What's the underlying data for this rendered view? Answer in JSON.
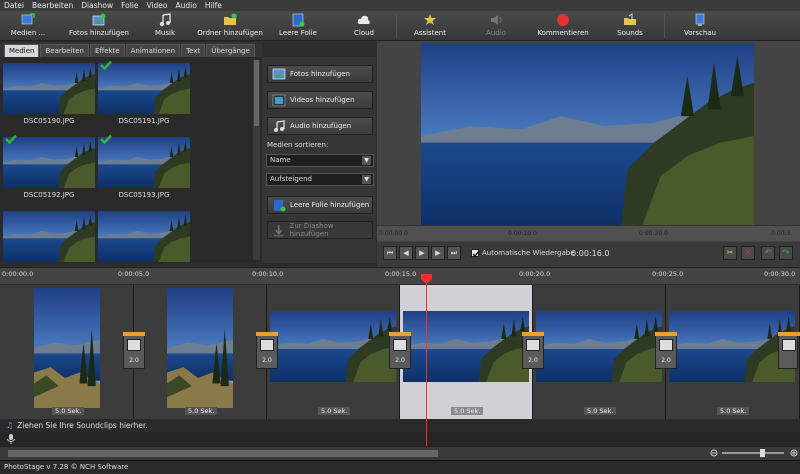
{
  "menu": [
    "Datei",
    "Bearbeiten",
    "Diashow",
    "Folie",
    "Video",
    "Audio",
    "Hilfe"
  ],
  "toolbar": [
    {
      "label": "Medien ...",
      "icon": "media-icon"
    },
    {
      "label": "Fotos hinzufügen",
      "icon": "photo-add-icon"
    },
    {
      "label": "Musik",
      "icon": "music-icon"
    },
    {
      "label": "Ordner hinzufügen",
      "icon": "folder-add-icon"
    },
    {
      "label": "Leere Folie",
      "icon": "blank-slide-icon"
    },
    {
      "label": "Cloud",
      "icon": "cloud-icon"
    },
    {
      "label": "Assistent",
      "icon": "wizard-icon"
    },
    {
      "label": "Audio",
      "icon": "audio-icon"
    },
    {
      "label": "Kommentieren",
      "icon": "record-icon"
    },
    {
      "label": "Sounds",
      "icon": "sounds-icon"
    },
    {
      "label": "Vorschau",
      "icon": "preview-icon"
    }
  ],
  "tabs": [
    "Medien",
    "Bearbeiten",
    "Effekte",
    "Animationen",
    "Text",
    "Übergänge"
  ],
  "media": [
    {
      "name": "DSC05190.JPG",
      "used": false
    },
    {
      "name": "DSC05191.JPG",
      "used": true
    },
    {
      "name": "DSC05192.JPG",
      "used": true
    },
    {
      "name": "DSC05193.JPG",
      "used": true
    }
  ],
  "side": {
    "add_photos": "Fotos hinzufügen",
    "add_videos": "Videos hinzufügen",
    "add_audio": "Audio hinzufügen",
    "sort_label": "Medien sortieren:",
    "sort_by": "Name",
    "sort_order": "Aufsteigend",
    "add_blank": "Leere Folie hinzufügen",
    "add_to_slideshow": "Zur Diashow hinzufügen"
  },
  "preview": {
    "ruler": [
      "0:00:00.0",
      "0:00:10.0",
      "0:00:20.0",
      "0:00:3"
    ],
    "autoplay_label": "Automatische Wiedergabe",
    "time": "0:00:16.0"
  },
  "timeline": {
    "ruler": [
      "0:00:00.0",
      "0:00:05.0",
      "0:00:10.0",
      "0:00:15.0",
      "0:00:20.0",
      "0:00:25.0",
      "0:00:30.0"
    ],
    "clips": [
      {
        "duration": "5.0 Sek."
      },
      {
        "duration": "5.0 Sek."
      },
      {
        "duration": "5.0 Sek."
      },
      {
        "duration": "5.0 Sek."
      },
      {
        "duration": "5.0 Sek."
      },
      {
        "duration": "5.0 Sek."
      }
    ],
    "transition_value": "2.0",
    "audio_hint": "Ziehen Sie Ihre Soundclips hierher."
  },
  "status": "PhotoStage v 7.28 © NCH Software",
  "colors": {
    "background": "#2d2d2d",
    "selected_clip": "#d0d0d6",
    "playhead": "#ff2a2a",
    "check": "#3ab13a"
  }
}
